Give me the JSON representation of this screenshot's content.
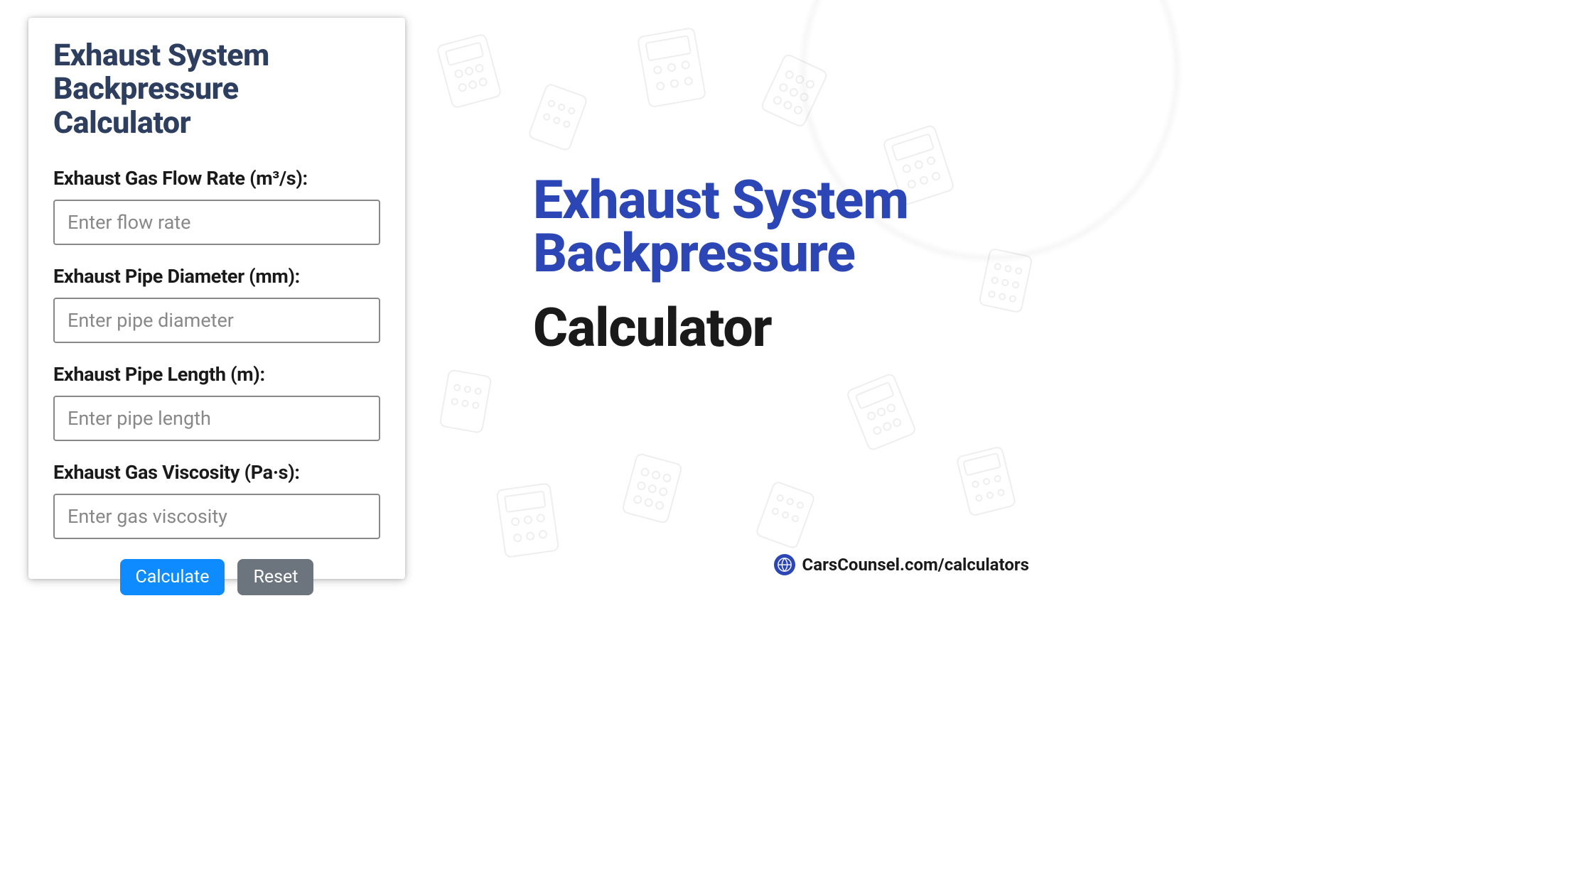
{
  "card": {
    "title": "Exhaust System Backpressure Calculator",
    "fields": [
      {
        "label": "Exhaust Gas Flow Rate (m³/s):",
        "placeholder": "Enter flow rate"
      },
      {
        "label": "Exhaust Pipe Diameter (mm):",
        "placeholder": "Enter pipe diameter"
      },
      {
        "label": "Exhaust Pipe Length (m):",
        "placeholder": "Enter pipe length"
      },
      {
        "label": "Exhaust Gas Viscosity (Pa·s):",
        "placeholder": "Enter gas viscosity"
      }
    ],
    "buttons": {
      "calculate": "Calculate",
      "reset": "Reset"
    }
  },
  "hero": {
    "title": "Exhaust System Backpressure",
    "subtitle": "Calculator"
  },
  "footer": {
    "url": "CarsCounsel.com/calculators"
  }
}
